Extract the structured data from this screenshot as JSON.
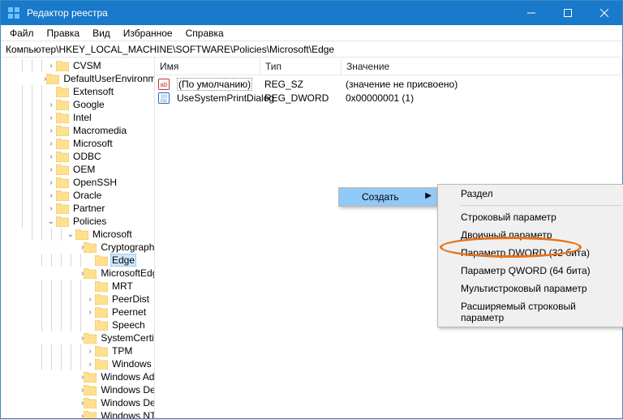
{
  "titlebar": {
    "title": "Редактор реестра"
  },
  "menubar": [
    "Файл",
    "Правка",
    "Вид",
    "Избранное",
    "Справка"
  ],
  "address": "Компьютер\\HKEY_LOCAL_MACHINE\\SOFTWARE\\Policies\\Microsoft\\Edge",
  "tree_level1": [
    {
      "label": "CVSM",
      "expand": ">"
    },
    {
      "label": "DefaultUserEnvironm",
      "expand": ">"
    },
    {
      "label": "Extensoft",
      "expand": ""
    },
    {
      "label": "Google",
      "expand": ">"
    },
    {
      "label": "Intel",
      "expand": ">"
    },
    {
      "label": "Macromedia",
      "expand": ">"
    },
    {
      "label": "Microsoft",
      "expand": ">"
    },
    {
      "label": "ODBC",
      "expand": ">"
    },
    {
      "label": "OEM",
      "expand": ">"
    },
    {
      "label": "OpenSSH",
      "expand": ">"
    },
    {
      "label": "Oracle",
      "expand": ">"
    },
    {
      "label": "Partner",
      "expand": ">"
    }
  ],
  "policies_label": "Policies",
  "microsoft_label": "Microsoft",
  "tree_level3": [
    {
      "label": "Cryptography",
      "expand": ">"
    },
    {
      "label": "Edge",
      "expand": "",
      "selected": true
    },
    {
      "label": "MicrosoftEdge",
      "expand": ">"
    },
    {
      "label": "MRT",
      "expand": ""
    },
    {
      "label": "PeerDist",
      "expand": ">"
    },
    {
      "label": "Peernet",
      "expand": ">"
    },
    {
      "label": "Speech",
      "expand": ""
    },
    {
      "label": "SystemCertific",
      "expand": ">"
    },
    {
      "label": "TPM",
      "expand": ">"
    },
    {
      "label": "Windows",
      "expand": ">"
    },
    {
      "label": "Windows Adva",
      "expand": ">"
    },
    {
      "label": "Windows Defe",
      "expand": ">"
    },
    {
      "label": "Windows Defe",
      "expand": ">"
    },
    {
      "label": "Windows NT",
      "expand": ">"
    }
  ],
  "columns": {
    "name": "Имя",
    "type": "Тип",
    "value": "Значение"
  },
  "rows": [
    {
      "icon": "str",
      "name": "(По умолчанию)",
      "type": "REG_SZ",
      "value": "(значение не присвоено)",
      "default": true
    },
    {
      "icon": "bin",
      "name": "UseSystemPrintDialog",
      "type": "REG_DWORD",
      "value": "0x00000001 (1)"
    }
  ],
  "ctx_primary": "Создать",
  "ctx_sub": [
    "Раздел",
    "Строковый параметр",
    "Двоичный параметр",
    "Параметр DWORD (32 бита)",
    "Параметр QWORD (64 бита)",
    "Мультистроковый параметр",
    "Расширяемый строковый параметр"
  ]
}
